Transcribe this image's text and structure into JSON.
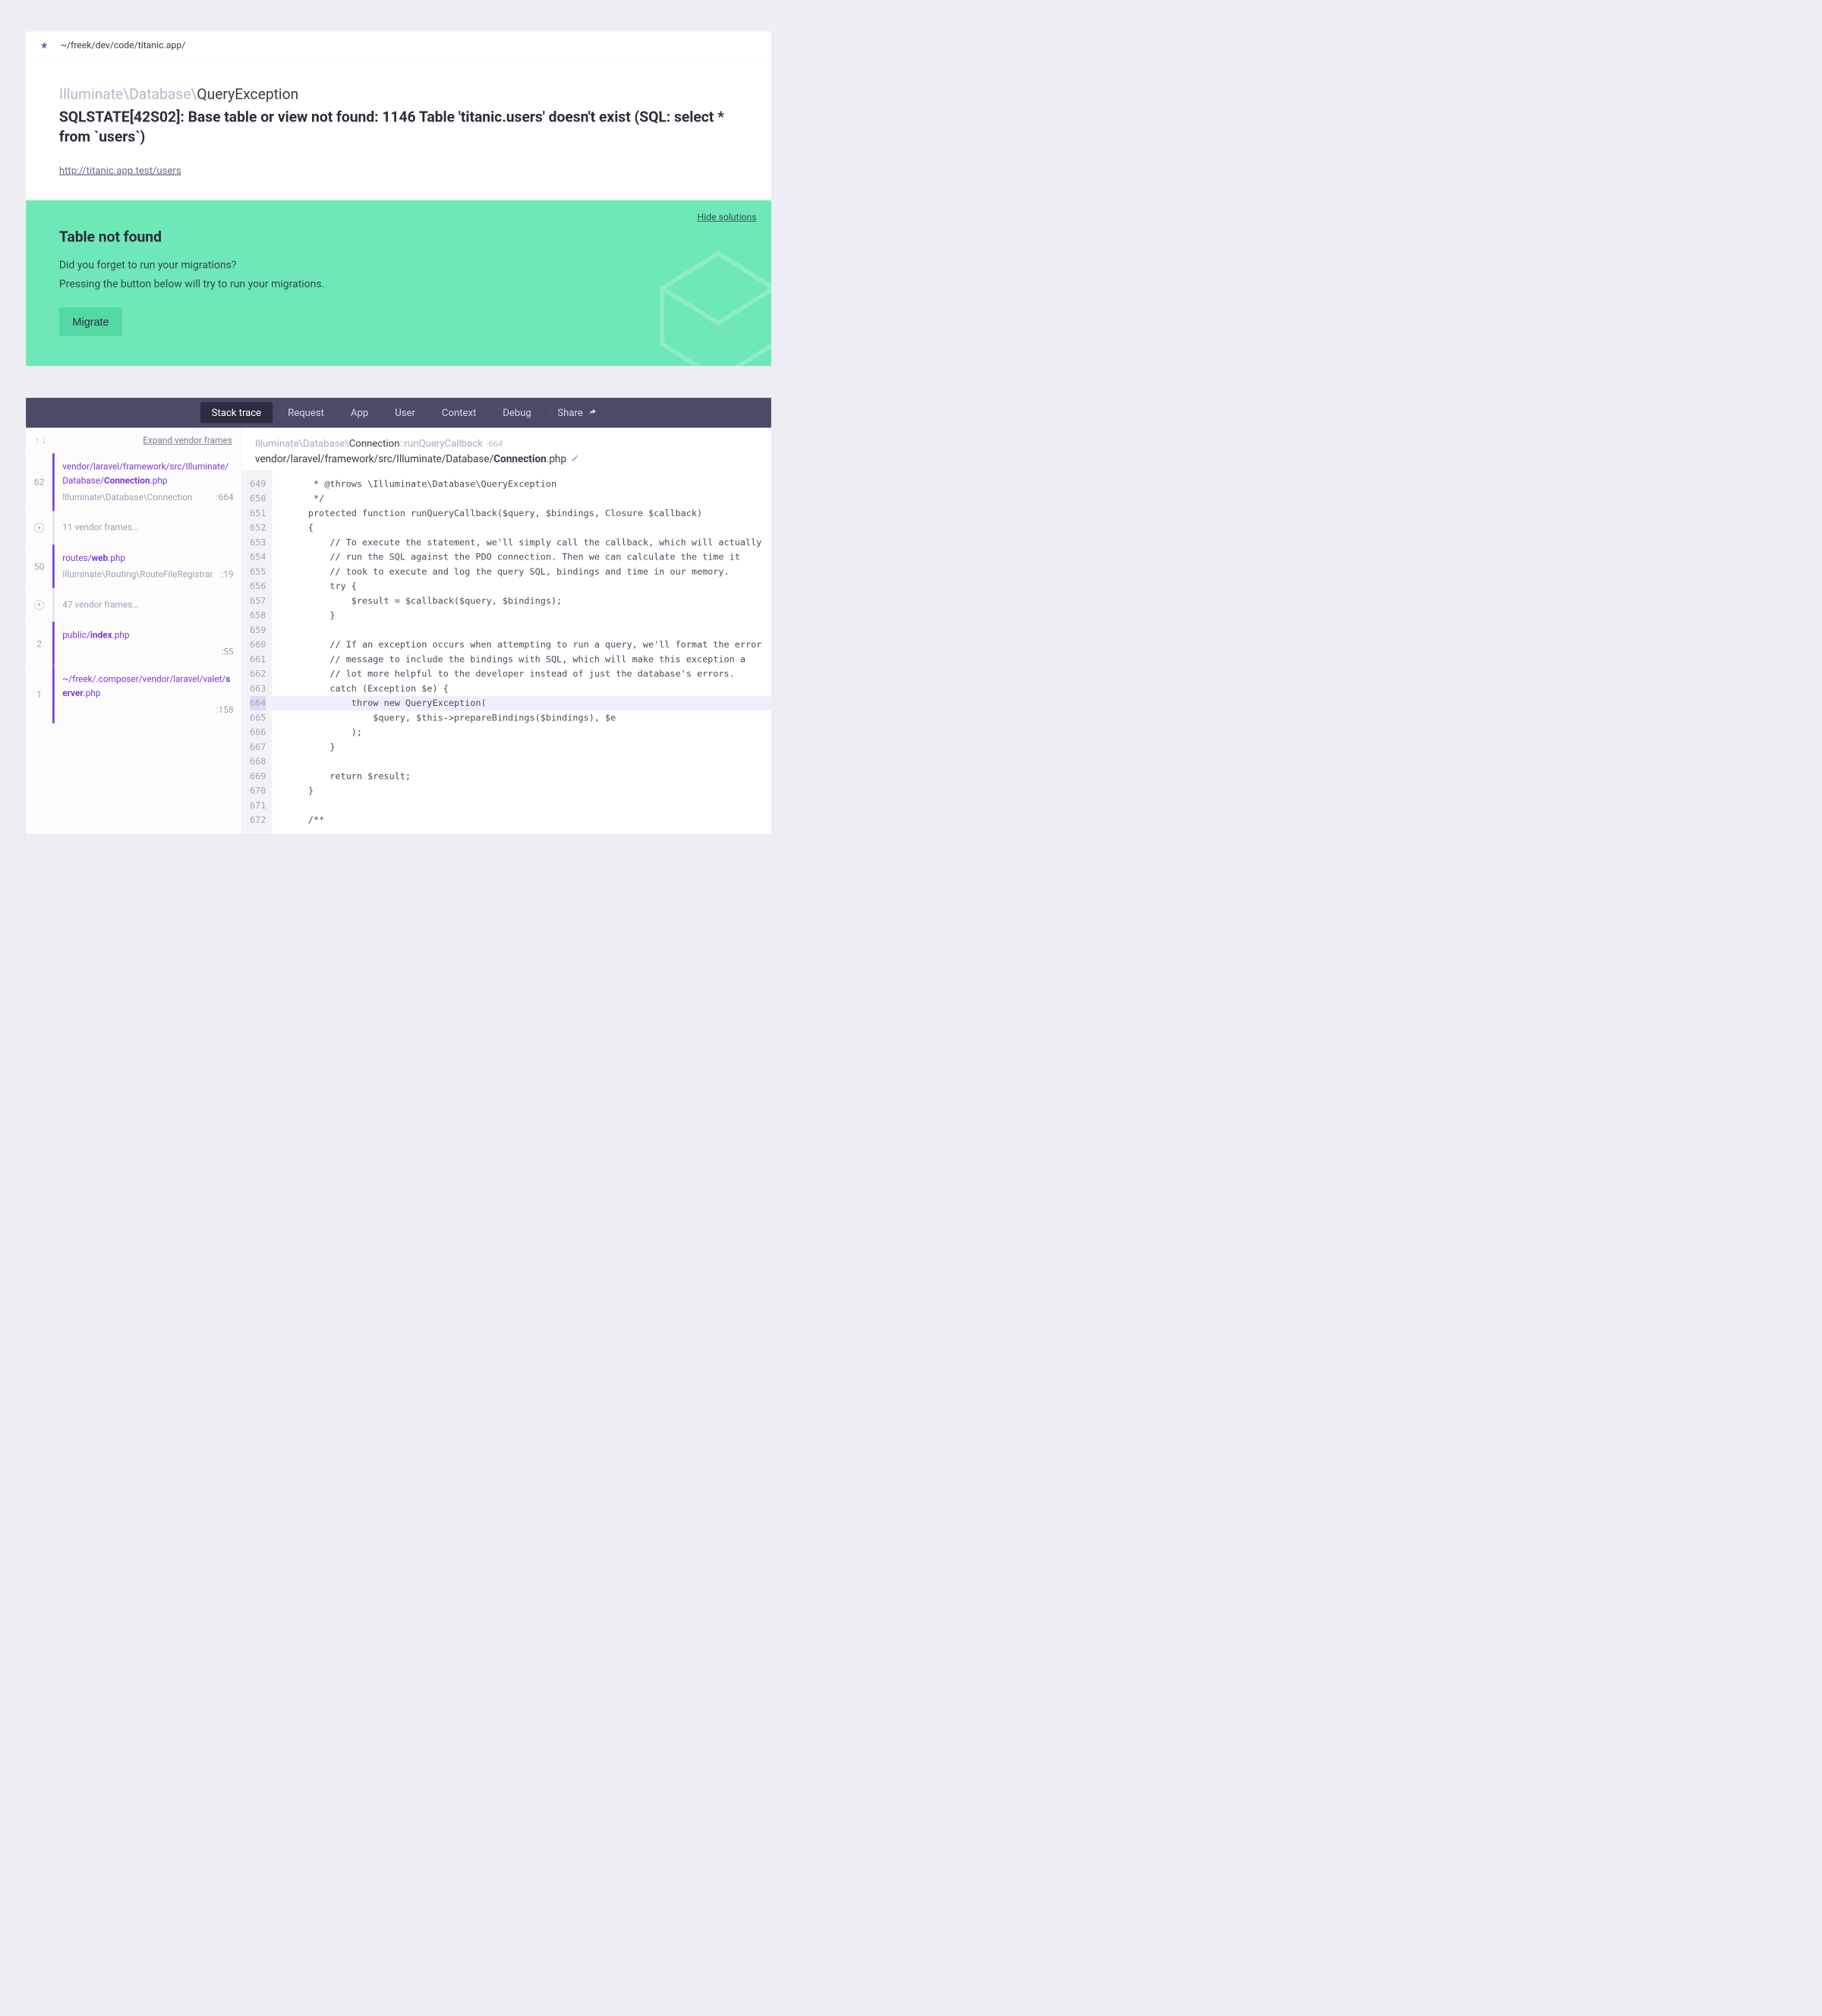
{
  "topbar": {
    "path": "~/freek/dev/code/titanic.app/"
  },
  "exception": {
    "namespace": "Illuminate\\Database\\",
    "short_name": "QueryException",
    "message": "SQLSTATE[42S02]: Base table or view not found: 1146 Table 'titanic.users' doesn't exist (SQL: select * from `users`)",
    "url": "http://titanic.app.test/users"
  },
  "solution": {
    "hide_label": "Hide solutions",
    "title": "Table not found",
    "line1": "Did you forget to run your migrations?",
    "line2": "Pressing the button below will try to run your migrations.",
    "button": "Migrate"
  },
  "nav": {
    "tabs": [
      "Stack trace",
      "Request",
      "App",
      "User",
      "Context",
      "Debug"
    ],
    "share": "Share"
  },
  "trace_header": {
    "expand": "Expand vendor frames"
  },
  "frames": [
    {
      "num": "62",
      "kind": "purple",
      "path_pre": "vendor/laravel/framework/src/Illuminate/Database/",
      "path_bold": "Connection",
      "path_post": ".php",
      "meta_left": "Illuminate\\Database\\Connection",
      "meta_right": ":664"
    },
    {
      "num": "plus",
      "kind": "collapsed",
      "collapsed_text": "11 vendor frames…"
    },
    {
      "num": "50",
      "kind": "purple",
      "path_pre": "routes/",
      "path_bold": "web",
      "path_post": ".php",
      "meta_left": "Illuminate\\Routing\\RouteFileRegistrar",
      "meta_right": ":19"
    },
    {
      "num": "plus",
      "kind": "collapsed",
      "collapsed_text": "47 vendor frames…"
    },
    {
      "num": "2",
      "kind": "purple",
      "path_pre": "public/",
      "path_bold": "index",
      "path_post": ".php",
      "meta_left": "",
      "meta_right": ":55"
    },
    {
      "num": "1",
      "kind": "purple",
      "path_pre": "~/freek/.composer/vendor/laravel/valet/",
      "path_bold": "server",
      "path_post": ".php",
      "meta_left": "",
      "meta_right": ":158"
    }
  ],
  "code_header": {
    "ns": "Illuminate\\Database\\",
    "cls": "Connection",
    "sep": "::",
    "method": "runQueryCallback",
    "line": ":664",
    "file_pre": "vendor/laravel/framework/src/Illuminate/Database/",
    "file_bold": "Connection",
    "file_post": ".php"
  },
  "code": {
    "start": 649,
    "highlight": 664,
    "lines": [
      "     * @throws \\Illuminate\\Database\\QueryException",
      "     */",
      "    protected function runQueryCallback($query, $bindings, Closure $callback)",
      "    {",
      "        // To execute the statement, we'll simply call the callback, which will actually",
      "        // run the SQL against the PDO connection. Then we can calculate the time it",
      "        // took to execute and log the query SQL, bindings and time in our memory.",
      "        try {",
      "            $result = $callback($query, $bindings);",
      "        }",
      "",
      "        // If an exception occurs when attempting to run a query, we'll format the error",
      "        // message to include the bindings with SQL, which will make this exception a",
      "        // lot more helpful to the developer instead of just the database's errors.",
      "        catch (Exception $e) {",
      "            throw new QueryException(",
      "                $query, $this->prepareBindings($bindings), $e",
      "            );",
      "        }",
      "",
      "        return $result;",
      "    }",
      "",
      "    /**"
    ]
  }
}
